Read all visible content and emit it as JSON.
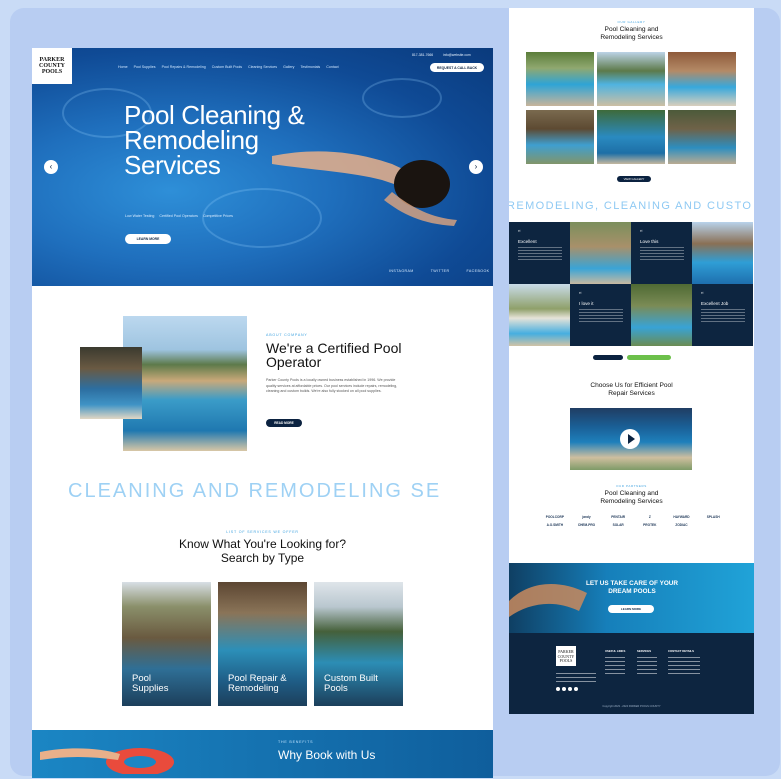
{
  "brand": {
    "logo_lines": [
      "PARKER",
      "COUNTY",
      "POOLS"
    ]
  },
  "nav": {
    "items": [
      "Home",
      "Pool Supplies",
      "Pool Repairs & Remodeling",
      "Custom Built Pools",
      "Cleaning Services",
      "Gallery",
      "Testimonials",
      "Contact"
    ],
    "phone": "817-381-7666",
    "email": "info@website.com",
    "request_button": "REQUEST A CALL BACK"
  },
  "hero": {
    "title": "Pool Cleaning & Remodeling Services",
    "tags": [
      "Low Water Testing",
      "Certified Pool Operators",
      "Competitive Prices"
    ],
    "learn_button": "LEARN MORE",
    "prev": "‹",
    "next": "›",
    "socials": [
      "INSTAGRAM",
      "TWITTER",
      "FACEBOOK"
    ]
  },
  "about": {
    "kicker": "ABOUT COMPANY",
    "title": "We're a Certified Pool Operator",
    "text": "Parker County Pools is a locally owned business established in 1996. We provide quality services at affordable prices. Our pool services include repairs, remodeling, cleaning and custom builds. We're also fully stocked on all pool supplies.",
    "button": "READ MORE"
  },
  "marquee_left": "CLEANING AND REMODELING SE",
  "search": {
    "kicker": "LIST OF SERVICES WE OFFER",
    "title": "Know What You're Looking for? Search by Type",
    "cards": [
      "Pool Supplies",
      "Pool Repair & Remodeling",
      "Custom Built Pools"
    ]
  },
  "why": {
    "kicker": "THE BENEFITS",
    "title": "Why Book with Us"
  },
  "right": {
    "gallery_kicker": "OUR GALLERY",
    "gallery_title": "Pool Cleaning and Remodeling Services",
    "gallery_button": "VIEW GALLERY",
    "marquee": "REMODELING, CLEANING AND CUSTO",
    "testimonials": [
      {
        "name": "Excellent"
      },
      {
        "name": "Love this"
      },
      {
        "name": "I love it"
      },
      {
        "name": "Excellent Job"
      }
    ],
    "testi_quote": "“",
    "choose_title": "Choose Us for Efficient Pool Repair Services",
    "brands_kicker": "OUR PARTNERS",
    "brands_title": "Pool Cleaning and Remodeling Services",
    "brands": [
      "POOLCORP",
      "jandy",
      "PENTAIR",
      "Z",
      "HAYWARD",
      "SPLASH",
      "A.O.SMITH",
      "CHEM-PRO",
      "SOLAR",
      "PROTEK",
      "ZODIAC",
      ""
    ],
    "cta_title": "LET US TAKE CARE OF YOUR DREAM POOLS",
    "cta_button": "LEARN MORE",
    "footer_logo": "PARKER COUNTY POOLS",
    "footer_heads": [
      "USEFUL LINKS",
      "SERVICES",
      "CONTACT DETAILS"
    ],
    "copyright": "Copyright 2023 - 2024 PARKER POOLS COUNTY"
  }
}
